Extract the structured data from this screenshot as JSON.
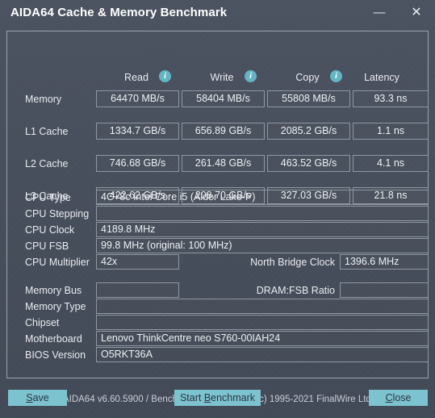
{
  "window": {
    "title": "AIDA64 Cache & Memory Benchmark",
    "minimize_glyph": "—",
    "close_glyph": "✕",
    "accent_color": "#7cc3cf",
    "background_color": "#474e5b",
    "border_color": "#9aa3af"
  },
  "benchmark": {
    "columns": [
      {
        "label": "Read",
        "info_icon": "info-icon",
        "info_glyph": "i"
      },
      {
        "label": "Write",
        "info_icon": "info-icon",
        "info_glyph": "i"
      },
      {
        "label": "Copy",
        "info_icon": "info-icon",
        "info_glyph": "i"
      },
      {
        "label": "Latency",
        "info_icon": null,
        "info_glyph": ""
      }
    ],
    "rows": [
      {
        "label": "Memory",
        "read": "64470 MB/s",
        "write": "58404 MB/s",
        "copy": "55808 MB/s",
        "latency": "93.3 ns"
      },
      {
        "label": "L1 Cache",
        "read": "1334.7 GB/s",
        "write": "656.89 GB/s",
        "copy": "2085.2 GB/s",
        "latency": "1.1 ns"
      },
      {
        "label": "L2 Cache",
        "read": "746.68 GB/s",
        "write": "261.48 GB/s",
        "copy": "463.52 GB/s",
        "latency": "4.1 ns"
      },
      {
        "label": "L3 Cache",
        "read": "422.62 GB/s",
        "write": "208.70 GB/s",
        "copy": "327.03 GB/s",
        "latency": "21.8 ns"
      }
    ]
  },
  "cpu_info": {
    "cpu_type_label": "CPU Type",
    "cpu_type_value": "4C+8c Intel Core i5  (Alder Lake-P)",
    "cpu_stepping_label": "CPU Stepping",
    "cpu_stepping_value": "",
    "cpu_clock_label": "CPU Clock",
    "cpu_clock_value": "4189.8 MHz",
    "cpu_fsb_label": "CPU FSB",
    "cpu_fsb_value": "99.8 MHz  (original: 100 MHz)",
    "cpu_multiplier_label": "CPU Multiplier",
    "cpu_multiplier_value": "42x",
    "north_bridge_clock_label": "North Bridge Clock",
    "north_bridge_clock_value": "1396.6 MHz"
  },
  "memory_info": {
    "memory_bus_label": "Memory Bus",
    "memory_bus_value": "",
    "dram_fsb_ratio_label": "DRAM:FSB Ratio",
    "dram_fsb_ratio_value": "",
    "memory_type_label": "Memory Type",
    "memory_type_value": "",
    "chipset_label": "Chipset",
    "chipset_value": "",
    "motherboard_label": "Motherboard",
    "motherboard_value": "Lenovo ThinkCentre neo S760-00IAH24",
    "bios_version_label": "BIOS Version",
    "bios_version_value": "O5RKT36A"
  },
  "version_text": "AIDA64 v6.60.5900 / BenchDLL 4.5.865.8-x64  (c) 1995-2021 FinalWire Ltd.",
  "buttons": {
    "save": {
      "pre": "",
      "accel": "S",
      "post": "ave"
    },
    "start": {
      "pre": "Start ",
      "accel": "B",
      "post": "enchmark"
    },
    "close": {
      "pre": "",
      "accel": "C",
      "post": "lose"
    }
  }
}
